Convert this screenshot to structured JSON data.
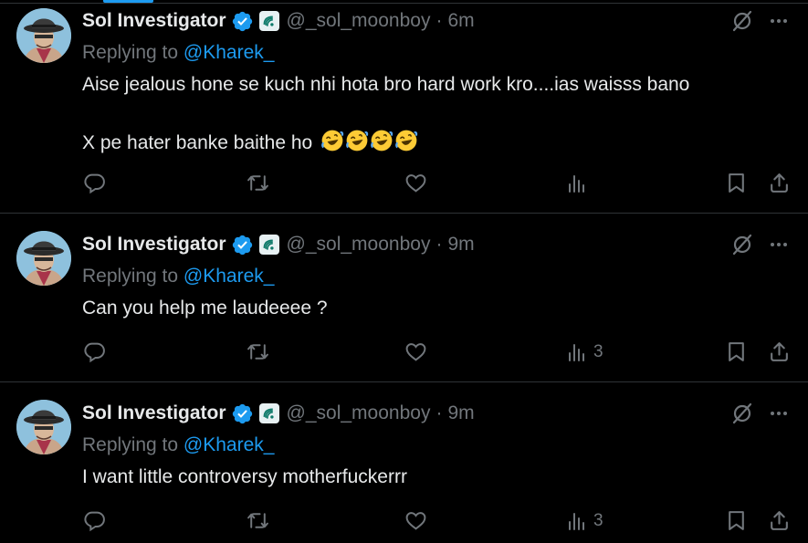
{
  "colors": {
    "background": "#000000",
    "text": "#e7e9ea",
    "muted": "#71767b",
    "accent": "#1d9bf0",
    "divider": "#2f3336"
  },
  "tweets": [
    {
      "name": "Sol Investigator",
      "handle": "@_sol_moonboy",
      "separator": "·",
      "time": "6m",
      "replying_prefix": "Replying to ",
      "replying_to": "@Kharek_",
      "lines": [
        "Aise jealous hone se kuch nhi hota bro hard work kro....ias waisss bano",
        "X pe hater banke baithe ho"
      ],
      "emoji": "rolling-on-floor-laughing x4",
      "views": ""
    },
    {
      "name": "Sol Investigator",
      "handle": "@_sol_moonboy",
      "separator": "·",
      "time": "9m",
      "replying_prefix": "Replying to ",
      "replying_to": "@Kharek_",
      "lines": [
        "Can you help me laudeeee ?"
      ],
      "views": "3"
    },
    {
      "name": "Sol Investigator",
      "handle": "@_sol_moonboy",
      "separator": "·",
      "time": "9m",
      "replying_prefix": "Replying to ",
      "replying_to": "@Kharek_",
      "lines": [
        "I want little controversy motherfuckerrr"
      ],
      "views": "3"
    }
  ],
  "icons": {
    "verified": "verified-badge-icon",
    "affiliate": "affiliate-logo-icon",
    "grok": "grok-icon",
    "more": "more-icon",
    "reply": "reply-icon",
    "repost": "repost-icon",
    "like": "like-icon",
    "views": "views-icon",
    "bookmark": "bookmark-icon",
    "share": "share-icon"
  }
}
